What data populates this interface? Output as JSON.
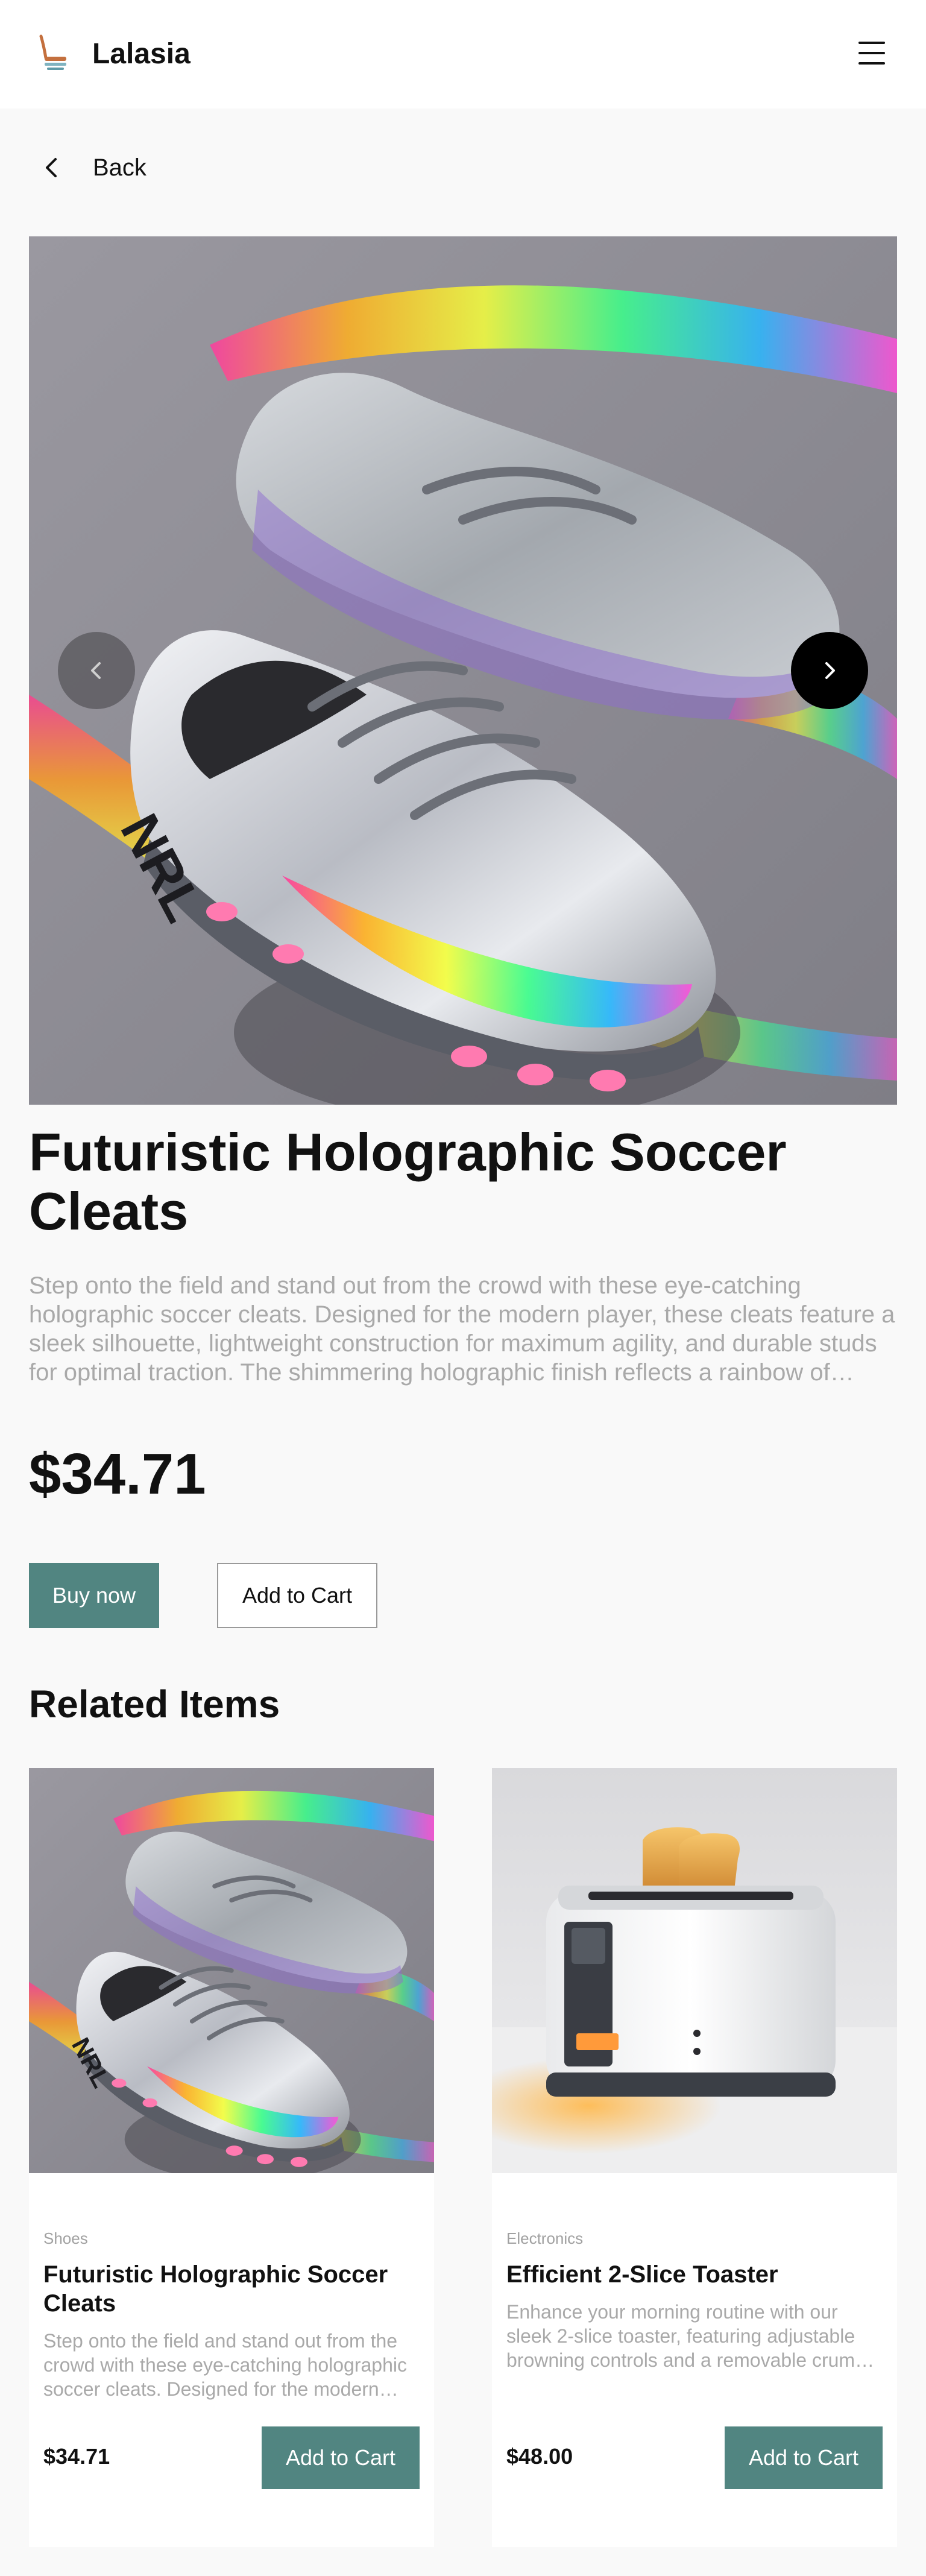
{
  "header": {
    "brand": "Lalasia",
    "logo_icon": "chair-logo-icon",
    "menu_icon": "hamburger-menu-icon"
  },
  "nav": {
    "back_label": "Back",
    "back_icon": "chevron-left-icon"
  },
  "product": {
    "title": "Futuristic Holographic Soccer Cleats",
    "description": "Step onto the field and stand out from the crowd with these eye-catching holographic soccer cleats. Designed for the modern player, these cleats feature a sleek silhouette, lightweight construction for maximum agility, and durable studs for optimal traction. The shimmering holographic finish reflects a rainbow of colors as you move.",
    "price": "$34.71",
    "image": "holographic-soccer-cleats-photo",
    "gallery_prev_icon": "chevron-left-icon",
    "gallery_next_icon": "chevron-right-icon"
  },
  "actions": {
    "buy_now": "Buy now",
    "add_to_cart": "Add to Cart"
  },
  "related": {
    "title": "Related Items",
    "items": [
      {
        "category": "Shoes",
        "title": "Futuristic Holographic Soccer Cleats",
        "description": "Step onto the field and stand out from the crowd with these eye-catching holographic soccer cleats. Designed for the modern player, these cleats feature a sleek silhouette.",
        "price": "$34.71",
        "button": "Add to Cart",
        "image": "holographic-soccer-cleats-photo"
      },
      {
        "category": "Electronics",
        "title": "Efficient 2-Slice Toaster",
        "description": "Enhance your morning routine with our sleek 2-slice toaster, featuring adjustable browning controls and a removable crumb tray for easy cleaning.",
        "price": "$48.00",
        "button": "Add to Cart",
        "image": "white-toaster-photo"
      }
    ]
  },
  "colors": {
    "accent": "#518581",
    "background": "#f9f9f9",
    "text": "#111111",
    "muted": "#a9a9a9"
  }
}
